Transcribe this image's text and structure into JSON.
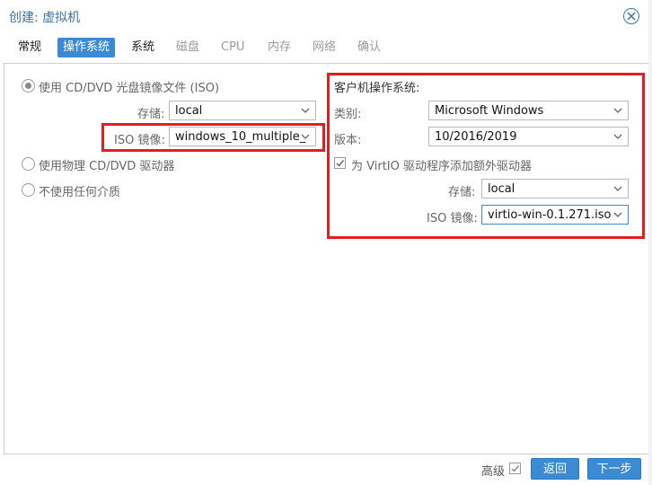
{
  "window": {
    "title": "创建: 虚拟机"
  },
  "tabs": [
    {
      "label": "常规",
      "state": "normal"
    },
    {
      "label": "操作系统",
      "state": "active"
    },
    {
      "label": "系统",
      "state": "normal"
    },
    {
      "label": "磁盘",
      "state": "disabled"
    },
    {
      "label": "CPU",
      "state": "disabled"
    },
    {
      "label": "内存",
      "state": "disabled"
    },
    {
      "label": "网络",
      "state": "disabled"
    },
    {
      "label": "确认",
      "state": "disabled"
    }
  ],
  "left": {
    "radio_iso": "使用 CD/DVD 光盘镜像文件 (ISO)",
    "storage_label": "存储:",
    "storage_value": "local",
    "iso_label": "ISO 镜像:",
    "iso_value": "windows_10_multiple_",
    "radio_physical": "使用物理 CD/DVD 驱动器",
    "radio_none": "不使用任何介质"
  },
  "right": {
    "heading": "客户机操作系统:",
    "type_label": "类别:",
    "type_value": "Microsoft Windows",
    "version_label": "版本:",
    "version_value": "10/2016/2019",
    "virtio_label": "为 VirtIO 驱动程序添加额外驱动器",
    "virtio_checked": true,
    "storage_label": "存储:",
    "storage_value": "local",
    "iso_label": "ISO 镜像:",
    "iso_value": "virtio-win-0.1.271.iso"
  },
  "footer": {
    "advanced_label": "高级",
    "advanced_checked": true,
    "back_label": "返回",
    "next_label": "下一步"
  },
  "colors": {
    "accent": "#3b8bd4",
    "highlight": "#e02020"
  }
}
